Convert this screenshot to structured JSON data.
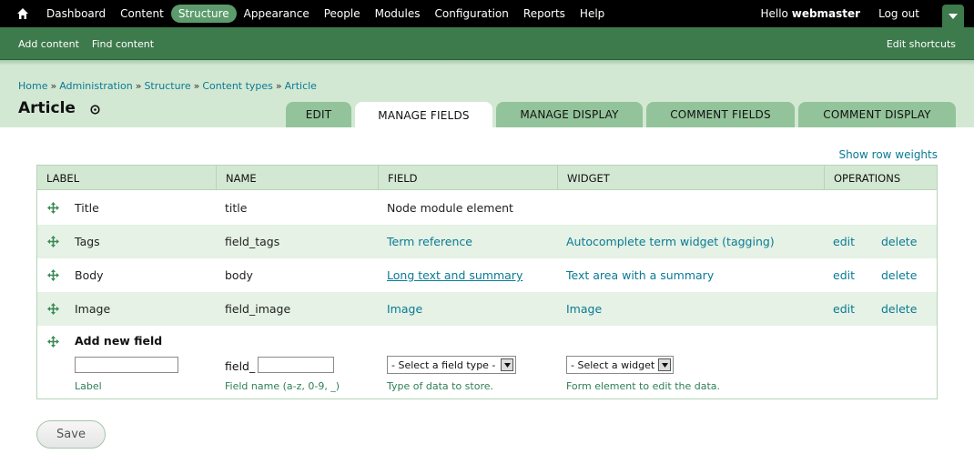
{
  "toolbar": {
    "menu": [
      {
        "label": "Dashboard"
      },
      {
        "label": "Content"
      },
      {
        "label": "Structure",
        "active": true
      },
      {
        "label": "Appearance"
      },
      {
        "label": "People"
      },
      {
        "label": "Modules"
      },
      {
        "label": "Configuration"
      },
      {
        "label": "Reports"
      },
      {
        "label": "Help"
      }
    ],
    "greeting": "Hello",
    "username": "webmaster",
    "logout_label": "Log out",
    "home_icon": "home-icon",
    "toggle_icon": "chevron-down-icon"
  },
  "shortcuts": {
    "links": [
      "Add content",
      "Find content"
    ],
    "edit_label": "Edit shortcuts"
  },
  "breadcrumb": {
    "items": [
      "Home",
      "Administration",
      "Structure",
      "Content types",
      "Article"
    ],
    "separator": "»"
  },
  "page": {
    "title": "Article",
    "title_icon": "add-shortcut-icon"
  },
  "tabs": [
    {
      "label": "EDIT"
    },
    {
      "label": "MANAGE FIELDS",
      "active": true
    },
    {
      "label": "MANAGE DISPLAY"
    },
    {
      "label": "COMMENT FIELDS"
    },
    {
      "label": "COMMENT DISPLAY"
    }
  ],
  "show_row_weights": "Show row weights",
  "table": {
    "headers": [
      "LABEL",
      "NAME",
      "FIELD",
      "WIDGET",
      "OPERATIONS"
    ],
    "rows": [
      {
        "label": "Title",
        "name": "title",
        "field": "Node module element",
        "field_link": false,
        "widget": "",
        "edit": "",
        "delete": ""
      },
      {
        "label": "Tags",
        "name": "field_tags",
        "field": "Term reference",
        "field_link": true,
        "widget": "Autocomplete term widget (tagging)",
        "edit": "edit",
        "delete": "delete"
      },
      {
        "label": "Body",
        "name": "body",
        "field": "Long text and summary",
        "field_link": true,
        "widget": "Text area with a summary",
        "edit": "edit",
        "delete": "delete"
      },
      {
        "label": "Image",
        "name": "field_image",
        "field": "Image",
        "field_link": true,
        "widget": "Image",
        "edit": "edit",
        "delete": "delete"
      }
    ],
    "add_new": {
      "heading": "Add new field",
      "label_value": "",
      "label_desc": "Label",
      "name_prefix": "field_",
      "name_value": "",
      "name_desc": "Field name (a-z, 0-9, _)",
      "type_select": "- Select a field type -",
      "type_desc": "Type of data to store.",
      "widget_select": "- Select a widget -",
      "widget_desc": "Form element to edit the data."
    }
  },
  "save_label": "Save",
  "colors": {
    "toolbar_bg": "#000000",
    "shortcuts_bg": "#3d7a4c",
    "header_bg": "#d3e8d3",
    "tab_bg": "#93c39a",
    "link": "#0a7a95",
    "active_menu": "#5c9b6b"
  }
}
